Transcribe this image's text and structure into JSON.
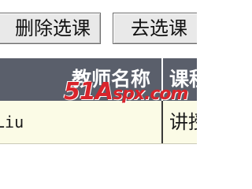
{
  "toolbar": {
    "remove_course_label": "删除选课",
    "go_select_label": "去选课"
  },
  "table": {
    "headers": {
      "teacher_name": "教师名称",
      "course_type": "课程类型"
    },
    "rows": [
      {
        "teacher_name": "Liu",
        "course_type": "讲授"
      }
    ]
  },
  "watermark": {
    "digits": "51",
    "letter": "A",
    "rest": "spx.com"
  },
  "colors": {
    "header_bg": "#5a5f6b",
    "row_bg": "#fbfbe6",
    "watermark": "#d9242b",
    "button_bg": "#e9e9e9"
  }
}
